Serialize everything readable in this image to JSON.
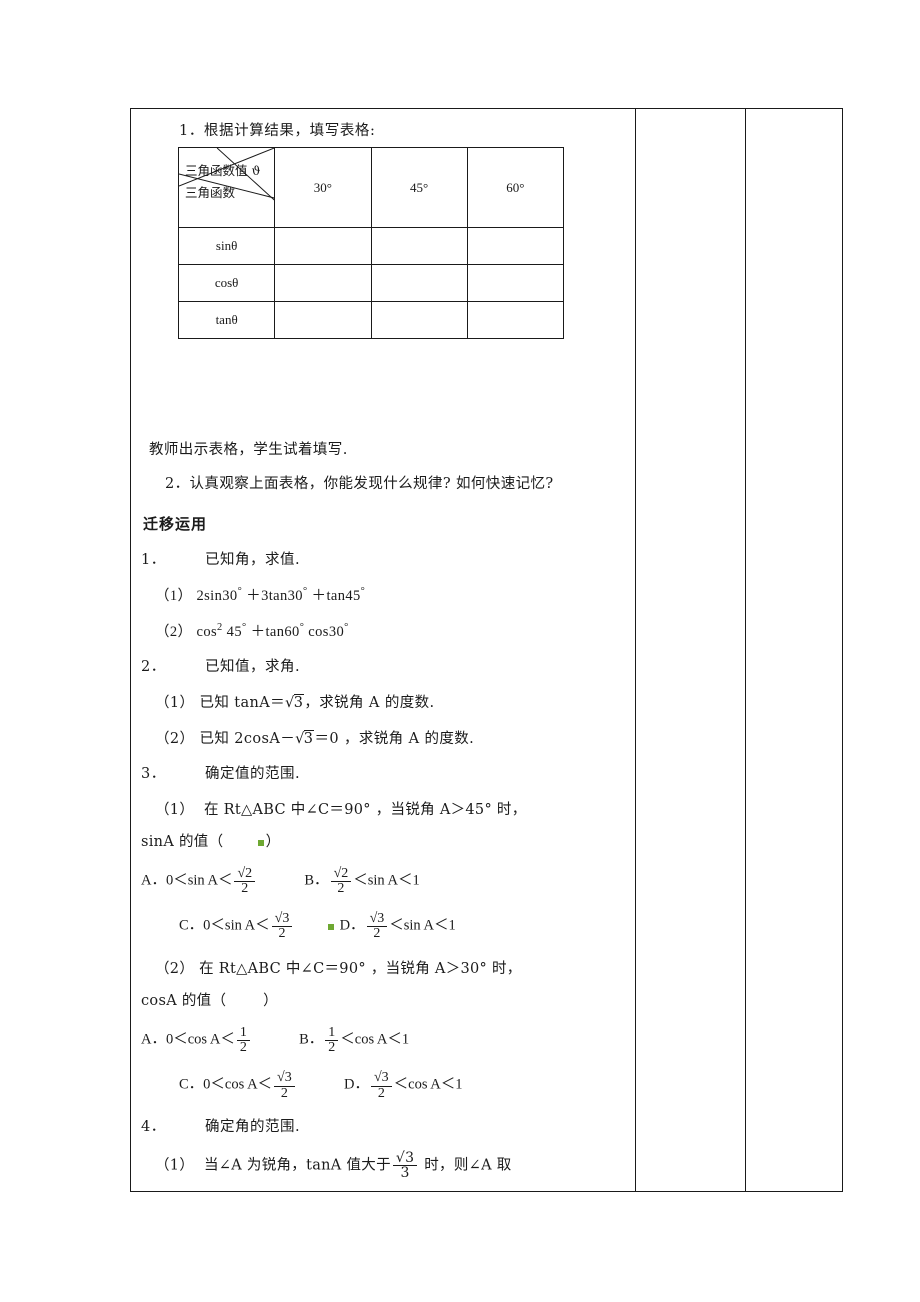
{
  "document": {
    "language": "zh-CN",
    "task1": "1．根据计算结果，填写表格:",
    "table": {
      "corner_top": "三角函数值 ϑ",
      "corner_bottom": "三角函数",
      "column_headers": [
        "30°",
        "45°",
        "60°"
      ],
      "row_headers": [
        "sinθ",
        "cosθ",
        "tanθ"
      ],
      "cells": [
        [
          "",
          "",
          ""
        ],
        [
          "",
          "",
          ""
        ],
        [
          "",
          "",
          ""
        ]
      ]
    },
    "caption_under_table": "教师出示表格，学生试着填写.",
    "task2": "2．认真观察上面表格，你能发现什么规律? 如何快速记忆?",
    "section_heading": "迁移运用",
    "items": [
      {
        "number": "1．",
        "title": "已知角，求值.",
        "parts": [
          {
            "label": "（1）",
            "text": "2sin30° ＋3tan30° ＋tan45°"
          },
          {
            "label": "（2）",
            "text": "cos²45° ＋tan60° cos30°"
          }
        ]
      },
      {
        "number": "2．",
        "title": "已知值，求角.",
        "parts": [
          {
            "label": "（1）",
            "pre": "已知 tanA＝",
            "radicand": "3",
            "post": "，求锐角 A 的度数."
          },
          {
            "label": "（2）",
            "pre": "已知 2cosA－",
            "radicand": "3",
            "post": "＝0 ，求锐角 A 的度数."
          }
        ]
      },
      {
        "number": "3．",
        "title": "确定值的范围.",
        "parts": [
          {
            "label": "（1）",
            "stem_line1": "在 Rt△ABC 中∠C＝90° ，当锐角 A＞45° 时，",
            "stem_line2_pre": "sinA 的值（",
            "stem_line2_post": "）",
            "choices": [
              {
                "key": "A．",
                "left": "0＜sin A＜",
                "num": "√2",
                "den": "2",
                "right": ""
              },
              {
                "key": "B．",
                "left": "",
                "num": "√2",
                "den": "2",
                "right": "＜sin A＜1"
              },
              {
                "key": "C．",
                "left": "0＜sin A＜",
                "num": "√3",
                "den": "2",
                "right": ""
              },
              {
                "key": "D．",
                "left": "",
                "num": "√3",
                "den": "2",
                "right": "＜sin A＜1"
              }
            ]
          },
          {
            "label": "（2）",
            "stem_line1": "在 Rt△ABC 中∠C＝90° ，当锐角 A＞30° 时，",
            "stem_line2_pre": "cosA 的值（",
            "stem_line2_post": "）",
            "choices": [
              {
                "key": "A．",
                "left": "0＜cos A＜",
                "num": "1",
                "den": "2",
                "right": ""
              },
              {
                "key": "B．",
                "left": "",
                "num": "1",
                "den": "2",
                "right": "＜cos A＜1"
              },
              {
                "key": "C．",
                "left": "0＜cos A＜",
                "num": "√3",
                "den": "2",
                "right": ""
              },
              {
                "key": "D．",
                "left": "",
                "num": "√3",
                "den": "2",
                "right": "＜cos A＜1"
              }
            ]
          }
        ]
      },
      {
        "number": "4．",
        "title": "确定角的范围.",
        "parts": [
          {
            "label": "（1）",
            "pre": "当∠A 为锐角，tanA 值大于",
            "num": "√3",
            "den": "3",
            "post": "时，则∠A 取"
          }
        ]
      }
    ]
  }
}
